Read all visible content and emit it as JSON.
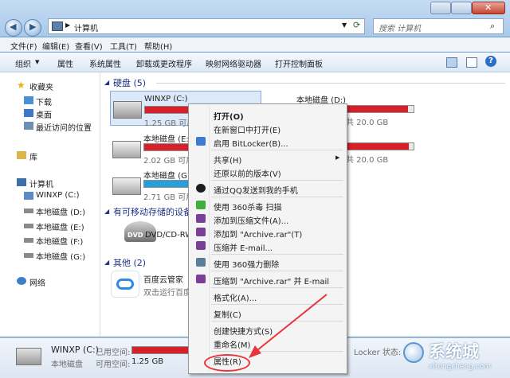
{
  "window": {
    "breadcrumb": "计算机",
    "search_placeholder": "搜索 计算机"
  },
  "menubar": [
    "文件(F)",
    "编辑(E)",
    "查看(V)",
    "工具(T)",
    "帮助(H)"
  ],
  "toolbar": [
    "组织",
    "属性",
    "系统属性",
    "卸载或更改程序",
    "映射网络驱动器",
    "打开控制面板"
  ],
  "nav": {
    "favorites": "收藏夹",
    "fav_items": [
      "下载",
      "桌面",
      "最近访问的位置"
    ],
    "libraries": "库",
    "computer": "计算机",
    "drives": [
      "WINXP (C:)",
      "本地磁盘 (D:)",
      "本地磁盘 (E:)",
      "本地磁盘 (F:)",
      "本地磁盘 (G:)"
    ],
    "network": "网络"
  },
  "content": {
    "hdd_header": "硬盘 (5)",
    "drives": [
      {
        "name": "WINXP (C:)",
        "free": "1.25 GB 可用",
        "fill": 0.95
      },
      {
        "name": "本地磁盘 (D:)",
        "free": "共 20.0 GB",
        "fill": 0.95
      },
      {
        "name": "本地磁盘 (E:)",
        "free": "2.02 GB 可用",
        "fill": 0.92
      },
      {
        "name": "本地磁盘 (F:)",
        "free": "共 20.0 GB",
        "fill": 0.96
      },
      {
        "name": "本地磁盘 (G:)",
        "free": "2.71 GB 可用",
        "fill": 0.55
      }
    ],
    "removable_header": "有可移动存储的设备",
    "dvd": "DVD/CD-RW",
    "other_header": "其他 (2)",
    "baidu_name": "百度云管家",
    "baidu_desc": "双击运行百度云"
  },
  "status": {
    "name": "WINXP (C:)",
    "type": "本地磁盘",
    "used_label": "已用空间:",
    "free_label": "可用空间:",
    "free_value": "1.25 GB",
    "bitlocker": "Locker 状态:",
    "fill": 0.92
  },
  "context_menu": [
    {
      "label": "打开(O)",
      "bold": true
    },
    {
      "label": "在新窗口中打开(E)"
    },
    {
      "label": "启用 BitLocker(B)...",
      "icon": "shield"
    },
    {
      "sep": true
    },
    {
      "label": "共享(H)",
      "arrow": "▶"
    },
    {
      "label": "还原以前的版本(V)"
    },
    {
      "sep": true
    },
    {
      "label": "通过QQ发送到我的手机",
      "icon": "qq"
    },
    {
      "sep": true
    },
    {
      "label": "使用 360杀毒 扫描",
      "icon": "360"
    },
    {
      "label": "添加到压缩文件(A)...",
      "icon": "rar"
    },
    {
      "label": "添加到 \"Archive.rar\"(T)",
      "icon": "rar"
    },
    {
      "label": "压缩并 E-mail...",
      "icon": "rar"
    },
    {
      "sep": true
    },
    {
      "label": "使用 360强力删除",
      "icon": "del"
    },
    {
      "sep": true
    },
    {
      "label": "压缩到 \"Archive.rar\" 并 E-mail",
      "icon": "rar"
    },
    {
      "sep": true
    },
    {
      "label": "格式化(A)..."
    },
    {
      "sep": true
    },
    {
      "label": "复制(C)"
    },
    {
      "sep": true
    },
    {
      "label": "创建快捷方式(S)"
    },
    {
      "label": "重命名(M)"
    },
    {
      "sep": true
    },
    {
      "label": "属性(R)"
    }
  ],
  "watermark": {
    "brand": "系统城",
    "url": "xitongcheng.com"
  },
  "colors": {
    "bar_red": "#d8202a",
    "bar_teal": "#26a0da",
    "annotation_red": "#e8343a"
  }
}
